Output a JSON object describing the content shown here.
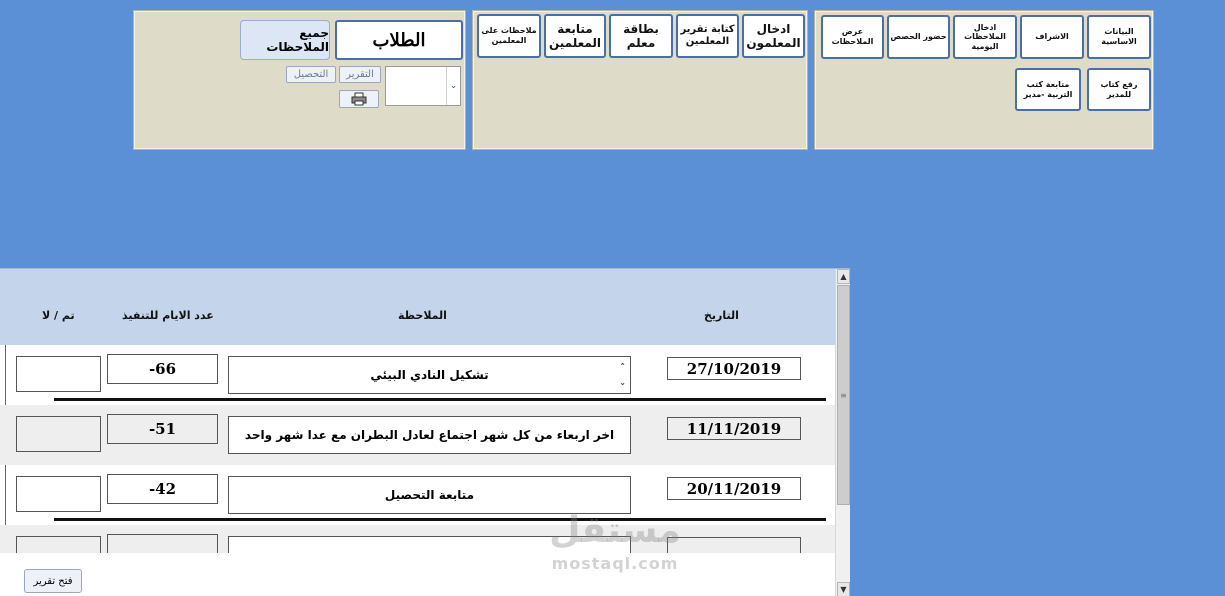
{
  "left_panel": {
    "students_label": "الطلاب",
    "all_notes_label": "جميع الملاحظات",
    "report_label": "التقرير",
    "achievement_label": "التحصيل",
    "combo_value": ""
  },
  "mid_panel": {
    "buttons": [
      {
        "label": "ادخال المعلمون"
      },
      {
        "label": "كتابة تقرير المعلمين"
      },
      {
        "label": "بطاقة معلم"
      },
      {
        "label": "متابعة المعلمين"
      },
      {
        "label": "ملاحظات على المعلمين"
      }
    ]
  },
  "right_panel": {
    "buttons": [
      {
        "label": "البيانات الاساسية"
      },
      {
        "label": "الاشراف"
      },
      {
        "label": "ادخال الملاحظات اليومية"
      },
      {
        "label": "حضور الحصص"
      },
      {
        "label": "عرض الملاحظات"
      },
      {
        "label": "رفع كتاب للمدير"
      },
      {
        "label": "متابعة كتب التربية -مدير"
      }
    ]
  },
  "list": {
    "columns": {
      "date": "التاريخ",
      "note": "الملاحظة",
      "days": "عدد الايام للتنفيذ",
      "done": "تم / لا"
    },
    "rows": [
      {
        "date": "27/10/2019",
        "note": "تشكيل النادي البيئي",
        "days": "-66",
        "done": ""
      },
      {
        "date": "11/11/2019",
        "note": "اخر اربعاء من كل شهر اجتماع لعادل البطران مع عدا شهر واحد",
        "days": "-51",
        "done": ""
      },
      {
        "date": "20/11/2019",
        "note": "متابعة التحصيل",
        "days": "-42",
        "done": ""
      },
      {
        "date": "",
        "note": "",
        "days": "",
        "done": ""
      }
    ],
    "open_report_label": "فتح تقرير"
  },
  "watermark": {
    "arabic": "مستقل",
    "latin": "mostaql.com"
  },
  "colors": {
    "background": "#5b8fd6",
    "panel": "#dedbc8",
    "header_band": "#c4d4ea",
    "button_border": "#4a6fa5"
  }
}
